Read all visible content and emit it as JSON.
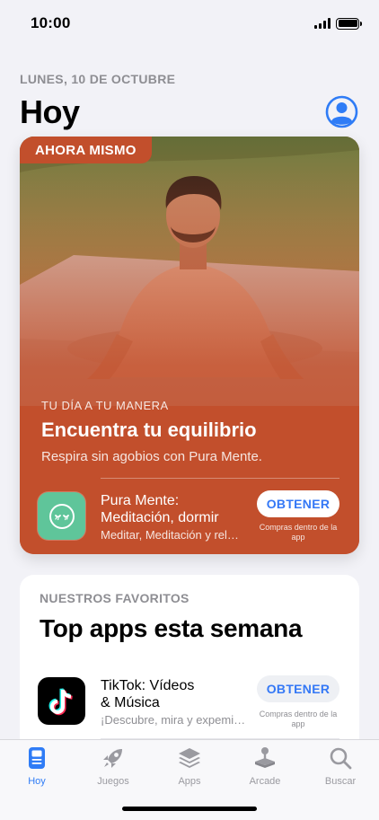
{
  "status_bar": {
    "time": "10:00"
  },
  "header": {
    "date": "LUNES, 10 DE OCTUBRE",
    "title": "Hoy"
  },
  "story": {
    "badge": "AHORA MISMO",
    "subtitle": "TU DÍA A TU MANERA",
    "title": "Encuentra tu equilibrio",
    "description": "Respira sin agobios con Pura Mente.",
    "accent_color": "#c24f2c",
    "app": {
      "icon": "sleeping-face-icon",
      "name_line1": "Pura Mente:",
      "name_line2": "Meditación, dormir",
      "tagline": "Meditar, Meditación y relajación",
      "button": "OBTENER",
      "iap_note": "Compras dentro de la app"
    }
  },
  "favorites": {
    "eyebrow": "NUESTROS FAVORITOS",
    "title": "Top apps esta semana",
    "apps": [
      {
        "icon": "tiktok-note-icon",
        "name_line1": "TikTok: Vídeos",
        "name_line2": "& Música",
        "tagline": "¡Descubre, mira y expemienta!",
        "button": "OBTENER",
        "iap_note": "Compras dentro de la app"
      }
    ]
  },
  "tab_bar": {
    "active_color": "#2f7cf6",
    "tabs": [
      {
        "label": "Hoy",
        "icon": "today-icon",
        "active": true
      },
      {
        "label": "Juegos",
        "icon": "rocket-icon",
        "active": false
      },
      {
        "label": "Apps",
        "icon": "layers-icon",
        "active": false
      },
      {
        "label": "Arcade",
        "icon": "joystick-icon",
        "active": false
      },
      {
        "label": "Buscar",
        "icon": "search-icon",
        "active": false
      }
    ]
  }
}
